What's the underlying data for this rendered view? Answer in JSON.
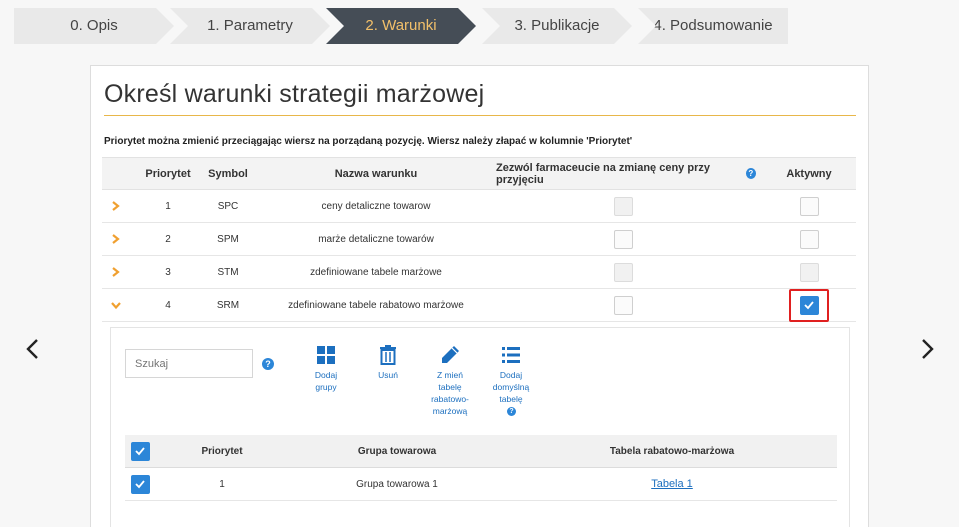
{
  "wizard": {
    "steps": [
      {
        "label": "0. Opis",
        "active": false
      },
      {
        "label": "1. Parametry",
        "active": false
      },
      {
        "label": "2. Warunki",
        "active": true
      },
      {
        "label": "3. Publikacje",
        "active": false
      },
      {
        "label": "4. Podsumowanie",
        "active": false
      }
    ]
  },
  "panel": {
    "title": "Określ warunki strategii marżowej",
    "hint": "Priorytet można zmienić przeciągając wiersz na porządaną pozycję. Wiersz należy złapać w kolumnie 'Priorytet'"
  },
  "conditions": {
    "headers": {
      "priority": "Priorytet",
      "symbol": "Symbol",
      "name": "Nazwa warunku",
      "allow": "Zezwól farmaceucie na zmianę ceny przy przyjęciu",
      "active": "Aktywny"
    },
    "rows": [
      {
        "priority": "1",
        "symbol": "SPC",
        "name": "ceny detaliczne towarow",
        "expanded": false,
        "allow": false,
        "active": false
      },
      {
        "priority": "2",
        "symbol": "SPM",
        "name": "marże detaliczne towarów",
        "expanded": false,
        "allow": false,
        "active": false
      },
      {
        "priority": "3",
        "symbol": "STM",
        "name": "zdefiniowane tabele marżowe",
        "expanded": false,
        "allow": false,
        "active": false
      },
      {
        "priority": "4",
        "symbol": "SRM",
        "name": "zdefiniowane tabele rabatowo marżowe",
        "expanded": true,
        "allow": false,
        "active": true
      }
    ]
  },
  "sub": {
    "search_placeholder": "Szukaj",
    "tools": {
      "add_groups": "Dodaj\ngrupy",
      "delete": "Usuń",
      "change_table": "Z mień\ntabelę\nrabatowo-\nmarżową",
      "add_default": "Dodaj\ndomyślną\ntabelę"
    },
    "groups": {
      "headers": {
        "priority": "Priorytet",
        "group": "Grupa towarowa",
        "table": "Tabela rabatowo-marżowa"
      },
      "rows": [
        {
          "priority": "1",
          "group": "Grupa towarowa 1",
          "table": "Tabela 1"
        }
      ]
    }
  },
  "colors": {
    "accent_blue": "#2c86d8",
    "active_step_bg": "#454d56",
    "active_step_text": "#f2c06a",
    "expand_orange": "#f0a030",
    "highlight_red": "#e02020"
  },
  "icons": {
    "prev": "chevron-left-icon",
    "next": "chevron-right-icon",
    "expand": "chevron-right-icon",
    "collapse": "chevron-down-icon",
    "add_groups": "grid-icon",
    "delete": "trash-icon",
    "change_table": "pencil-icon",
    "add_default": "list-icon"
  }
}
